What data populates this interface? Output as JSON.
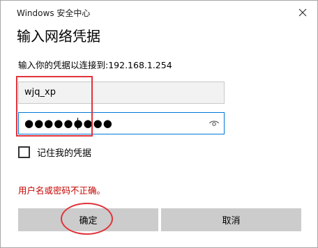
{
  "window": {
    "title": "Windows 安全中心",
    "close_icon": "close-icon"
  },
  "dialog": {
    "heading": "输入网络凭据",
    "prompt": "输入你的凭据以连接到:192.168.1.254"
  },
  "fields": {
    "username_value": "wjq_xp",
    "password_masked": "●●●●●●●●●",
    "password_reveal_icon": "eye-icon"
  },
  "remember": {
    "label": "记住我的凭据",
    "checked": false
  },
  "error": {
    "message": "用户名或密码不正确。",
    "color": "#c50500"
  },
  "buttons": {
    "ok_label": "确定",
    "cancel_label": "取消"
  },
  "colors": {
    "focus_border": "#0078d7",
    "button_bg": "#cccccc",
    "annotation": "#e0333a"
  }
}
